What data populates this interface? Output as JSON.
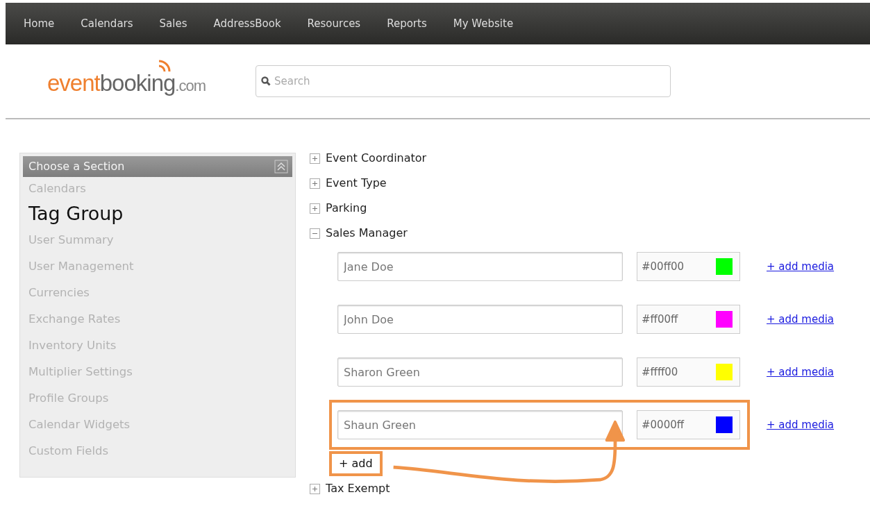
{
  "nav": [
    "Home",
    "Calendars",
    "Sales",
    "AddressBook",
    "Resources",
    "Reports",
    "My Website"
  ],
  "logo": {
    "parts": [
      "event",
      "booking",
      ".com"
    ]
  },
  "search": {
    "placeholder": "Search"
  },
  "sidebar": {
    "title": "Choose a Section",
    "items": [
      {
        "label": "Calendars",
        "selected": false
      },
      {
        "label": "Tag Group",
        "selected": true
      },
      {
        "label": "User Summary",
        "selected": false
      },
      {
        "label": "User Management",
        "selected": false
      },
      {
        "label": "Currencies",
        "selected": false
      },
      {
        "label": "Exchange Rates",
        "selected": false
      },
      {
        "label": "Inventory Units",
        "selected": false
      },
      {
        "label": "Multiplier Settings",
        "selected": false
      },
      {
        "label": "Profile Groups",
        "selected": false
      },
      {
        "label": "Calendar Widgets",
        "selected": false
      },
      {
        "label": "Custom Fields",
        "selected": false
      }
    ]
  },
  "groups": [
    {
      "label": "Event Coordinator",
      "expanded": false
    },
    {
      "label": "Event Type",
      "expanded": false
    },
    {
      "label": "Parking",
      "expanded": false
    },
    {
      "label": "Sales Manager",
      "expanded": true,
      "entries": [
        {
          "name": "Jane Doe",
          "hex": "#00ff00",
          "color": "#00ff00",
          "link": "+ add media",
          "highlighted": false
        },
        {
          "name": "John Doe",
          "hex": "#ff00ff",
          "color": "#ff00ff",
          "link": "+ add media",
          "highlighted": false
        },
        {
          "name": "Sharon Green",
          "hex": "#ffff00",
          "color": "#ffff00",
          "link": "+ add media",
          "highlighted": false
        },
        {
          "name": "Shaun Green",
          "hex": "#0000ff",
          "color": "#0000ff",
          "link": "+ add media",
          "highlighted": true
        }
      ],
      "add": {
        "label": "+ add",
        "highlighted": true
      }
    },
    {
      "label": "Tax Exempt",
      "expanded": false
    }
  ]
}
